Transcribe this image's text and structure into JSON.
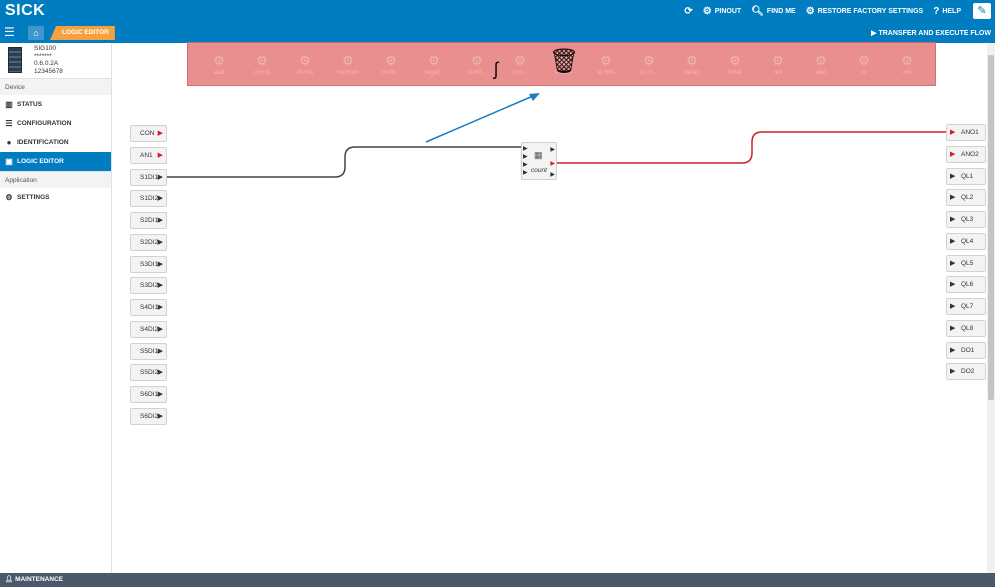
{
  "header": {
    "logo": "SICK",
    "actions": [
      {
        "icon": "refresh-icon",
        "label": ""
      },
      {
        "icon": "gears-icon",
        "label": "PINOUT"
      },
      {
        "icon": "search-icon",
        "label": "FIND ME"
      },
      {
        "icon": "gears-icon",
        "label": "RESTORE FACTORY SETTINGS"
      },
      {
        "icon": "help-icon",
        "label": "HELP"
      }
    ],
    "breadcrumb": "LOGIC EDITOR",
    "transfer_label": "TRANSFER AND EXECUTE FLOW"
  },
  "device": {
    "name": "SIG100",
    "masked": "*******",
    "version": "0.6.0.2A",
    "serial": "12345678"
  },
  "sidebar": {
    "device_section": "Device",
    "items": [
      {
        "label": "STATUS",
        "icon": "bar-chart-icon"
      },
      {
        "label": "CONFIGURATION",
        "icon": "list-icon"
      },
      {
        "label": "IDENTIFICATION",
        "icon": "info-icon"
      },
      {
        "label": "LOGIC EDITOR",
        "icon": "logic-editor-icon"
      }
    ],
    "application_section": "Application",
    "settings": {
      "label": "SETTINGS",
      "icon": "gears-icon"
    }
  },
  "footer": {
    "label": "MAINTENANCE",
    "icon": "user-icon"
  },
  "palette": {
    "blocks": [
      "add",
      "count",
      "divide",
      "modulo",
      "multi...",
      "negat...",
      "subtr...",
      "com...",
      "switch",
      "to bits",
      "to nt...",
      "delay",
      "timer",
      "not",
      "and",
      "or",
      "xor"
    ]
  },
  "inputs": [
    "CON",
    "AN1",
    "S1DI1",
    "S1DI2",
    "S2DI1",
    "S2DI2",
    "S3DI1",
    "S3DI2",
    "S4DI1",
    "S4DI2",
    "S5DI1",
    "S5DI2",
    "S6DI1",
    "S6DI2"
  ],
  "outputs": [
    "ANO1",
    "ANO2",
    "QL1",
    "QL2",
    "QL3",
    "QL4",
    "QL5",
    "QL6",
    "QL7",
    "QL8",
    "DO1",
    "DO2"
  ],
  "node": {
    "label": "count"
  },
  "colors": {
    "brand": "#007cc1",
    "accent": "#f6a03f",
    "analog": "#d11f26",
    "palette_bg": "#e98a8a"
  }
}
